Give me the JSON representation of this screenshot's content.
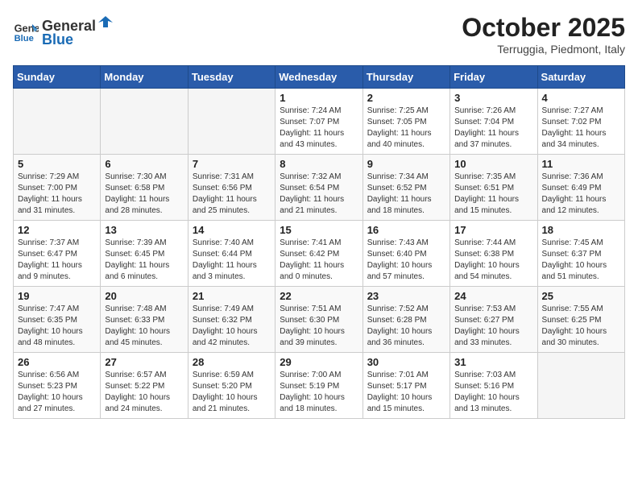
{
  "header": {
    "logo_general": "General",
    "logo_blue": "Blue",
    "month": "October 2025",
    "location": "Terruggia, Piedmont, Italy"
  },
  "weekdays": [
    "Sunday",
    "Monday",
    "Tuesday",
    "Wednesday",
    "Thursday",
    "Friday",
    "Saturday"
  ],
  "weeks": [
    [
      {
        "day": "",
        "info": ""
      },
      {
        "day": "",
        "info": ""
      },
      {
        "day": "",
        "info": ""
      },
      {
        "day": "1",
        "info": "Sunrise: 7:24 AM\nSunset: 7:07 PM\nDaylight: 11 hours\nand 43 minutes."
      },
      {
        "day": "2",
        "info": "Sunrise: 7:25 AM\nSunset: 7:05 PM\nDaylight: 11 hours\nand 40 minutes."
      },
      {
        "day": "3",
        "info": "Sunrise: 7:26 AM\nSunset: 7:04 PM\nDaylight: 11 hours\nand 37 minutes."
      },
      {
        "day": "4",
        "info": "Sunrise: 7:27 AM\nSunset: 7:02 PM\nDaylight: 11 hours\nand 34 minutes."
      }
    ],
    [
      {
        "day": "5",
        "info": "Sunrise: 7:29 AM\nSunset: 7:00 PM\nDaylight: 11 hours\nand 31 minutes."
      },
      {
        "day": "6",
        "info": "Sunrise: 7:30 AM\nSunset: 6:58 PM\nDaylight: 11 hours\nand 28 minutes."
      },
      {
        "day": "7",
        "info": "Sunrise: 7:31 AM\nSunset: 6:56 PM\nDaylight: 11 hours\nand 25 minutes."
      },
      {
        "day": "8",
        "info": "Sunrise: 7:32 AM\nSunset: 6:54 PM\nDaylight: 11 hours\nand 21 minutes."
      },
      {
        "day": "9",
        "info": "Sunrise: 7:34 AM\nSunset: 6:52 PM\nDaylight: 11 hours\nand 18 minutes."
      },
      {
        "day": "10",
        "info": "Sunrise: 7:35 AM\nSunset: 6:51 PM\nDaylight: 11 hours\nand 15 minutes."
      },
      {
        "day": "11",
        "info": "Sunrise: 7:36 AM\nSunset: 6:49 PM\nDaylight: 11 hours\nand 12 minutes."
      }
    ],
    [
      {
        "day": "12",
        "info": "Sunrise: 7:37 AM\nSunset: 6:47 PM\nDaylight: 11 hours\nand 9 minutes."
      },
      {
        "day": "13",
        "info": "Sunrise: 7:39 AM\nSunset: 6:45 PM\nDaylight: 11 hours\nand 6 minutes."
      },
      {
        "day": "14",
        "info": "Sunrise: 7:40 AM\nSunset: 6:44 PM\nDaylight: 11 hours\nand 3 minutes."
      },
      {
        "day": "15",
        "info": "Sunrise: 7:41 AM\nSunset: 6:42 PM\nDaylight: 11 hours\nand 0 minutes."
      },
      {
        "day": "16",
        "info": "Sunrise: 7:43 AM\nSunset: 6:40 PM\nDaylight: 10 hours\nand 57 minutes."
      },
      {
        "day": "17",
        "info": "Sunrise: 7:44 AM\nSunset: 6:38 PM\nDaylight: 10 hours\nand 54 minutes."
      },
      {
        "day": "18",
        "info": "Sunrise: 7:45 AM\nSunset: 6:37 PM\nDaylight: 10 hours\nand 51 minutes."
      }
    ],
    [
      {
        "day": "19",
        "info": "Sunrise: 7:47 AM\nSunset: 6:35 PM\nDaylight: 10 hours\nand 48 minutes."
      },
      {
        "day": "20",
        "info": "Sunrise: 7:48 AM\nSunset: 6:33 PM\nDaylight: 10 hours\nand 45 minutes."
      },
      {
        "day": "21",
        "info": "Sunrise: 7:49 AM\nSunset: 6:32 PM\nDaylight: 10 hours\nand 42 minutes."
      },
      {
        "day": "22",
        "info": "Sunrise: 7:51 AM\nSunset: 6:30 PM\nDaylight: 10 hours\nand 39 minutes."
      },
      {
        "day": "23",
        "info": "Sunrise: 7:52 AM\nSunset: 6:28 PM\nDaylight: 10 hours\nand 36 minutes."
      },
      {
        "day": "24",
        "info": "Sunrise: 7:53 AM\nSunset: 6:27 PM\nDaylight: 10 hours\nand 33 minutes."
      },
      {
        "day": "25",
        "info": "Sunrise: 7:55 AM\nSunset: 6:25 PM\nDaylight: 10 hours\nand 30 minutes."
      }
    ],
    [
      {
        "day": "26",
        "info": "Sunrise: 6:56 AM\nSunset: 5:23 PM\nDaylight: 10 hours\nand 27 minutes."
      },
      {
        "day": "27",
        "info": "Sunrise: 6:57 AM\nSunset: 5:22 PM\nDaylight: 10 hours\nand 24 minutes."
      },
      {
        "day": "28",
        "info": "Sunrise: 6:59 AM\nSunset: 5:20 PM\nDaylight: 10 hours\nand 21 minutes."
      },
      {
        "day": "29",
        "info": "Sunrise: 7:00 AM\nSunset: 5:19 PM\nDaylight: 10 hours\nand 18 minutes."
      },
      {
        "day": "30",
        "info": "Sunrise: 7:01 AM\nSunset: 5:17 PM\nDaylight: 10 hours\nand 15 minutes."
      },
      {
        "day": "31",
        "info": "Sunrise: 7:03 AM\nSunset: 5:16 PM\nDaylight: 10 hours\nand 13 minutes."
      },
      {
        "day": "",
        "info": ""
      }
    ]
  ]
}
